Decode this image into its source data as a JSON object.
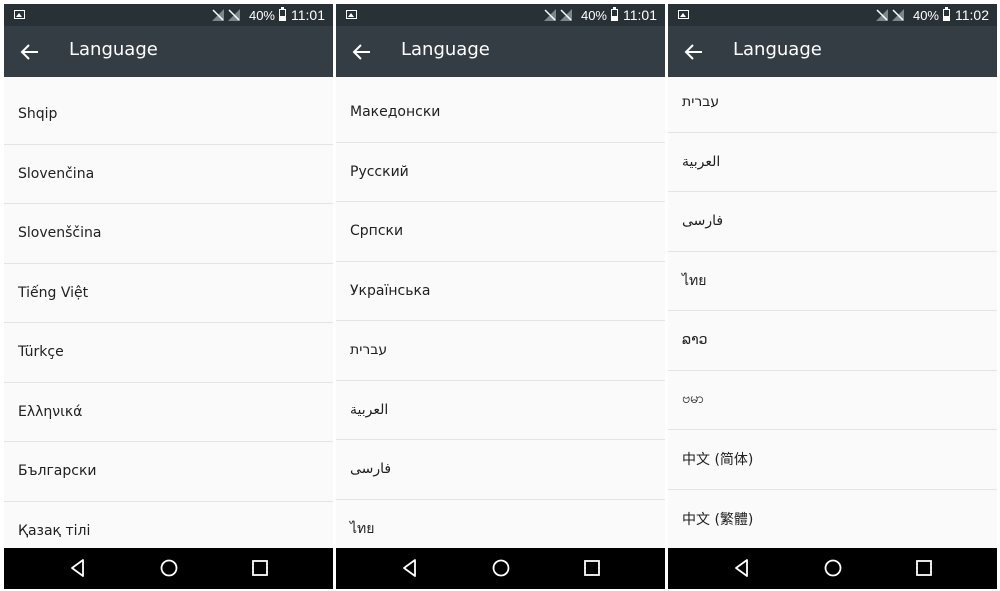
{
  "screens": [
    {
      "status": {
        "battery": "40%",
        "time": "11:01"
      },
      "title": "Language",
      "languages": [
        "Shqip",
        "Slovenčina",
        "Slovenščina",
        "Tiếng Việt",
        "Türkçe",
        "Ελληνικά",
        "Български",
        "Қазақ тілі"
      ]
    },
    {
      "status": {
        "battery": "40%",
        "time": "11:01"
      },
      "title": "Language",
      "languages": [
        "Македонски",
        "Русский",
        "Српски",
        "Українська",
        "עברית",
        "العربية",
        "فارسی",
        "ไทย"
      ]
    },
    {
      "status": {
        "battery": "40%",
        "time": "11:02"
      },
      "title": "Language",
      "languages": [
        "עברית",
        "العربية",
        "فارسی",
        "ไทย",
        "ລາວ",
        "ဗမာ",
        "中文 (简体)",
        "中文 (繁體)"
      ]
    }
  ],
  "icons": {
    "status_left": "image-notification-icon",
    "status_signal": "no-signal-icon",
    "battery": "battery-icon",
    "appbar": "back-arrow-icon",
    "nav": [
      "nav-back-icon",
      "nav-home-icon",
      "nav-recents-icon"
    ]
  },
  "colors": {
    "status_bar": "#283136",
    "app_bar": "#333d43",
    "list_background": "#fafafa",
    "divider": "#e4e4e4",
    "nav_bar": "#000000"
  }
}
